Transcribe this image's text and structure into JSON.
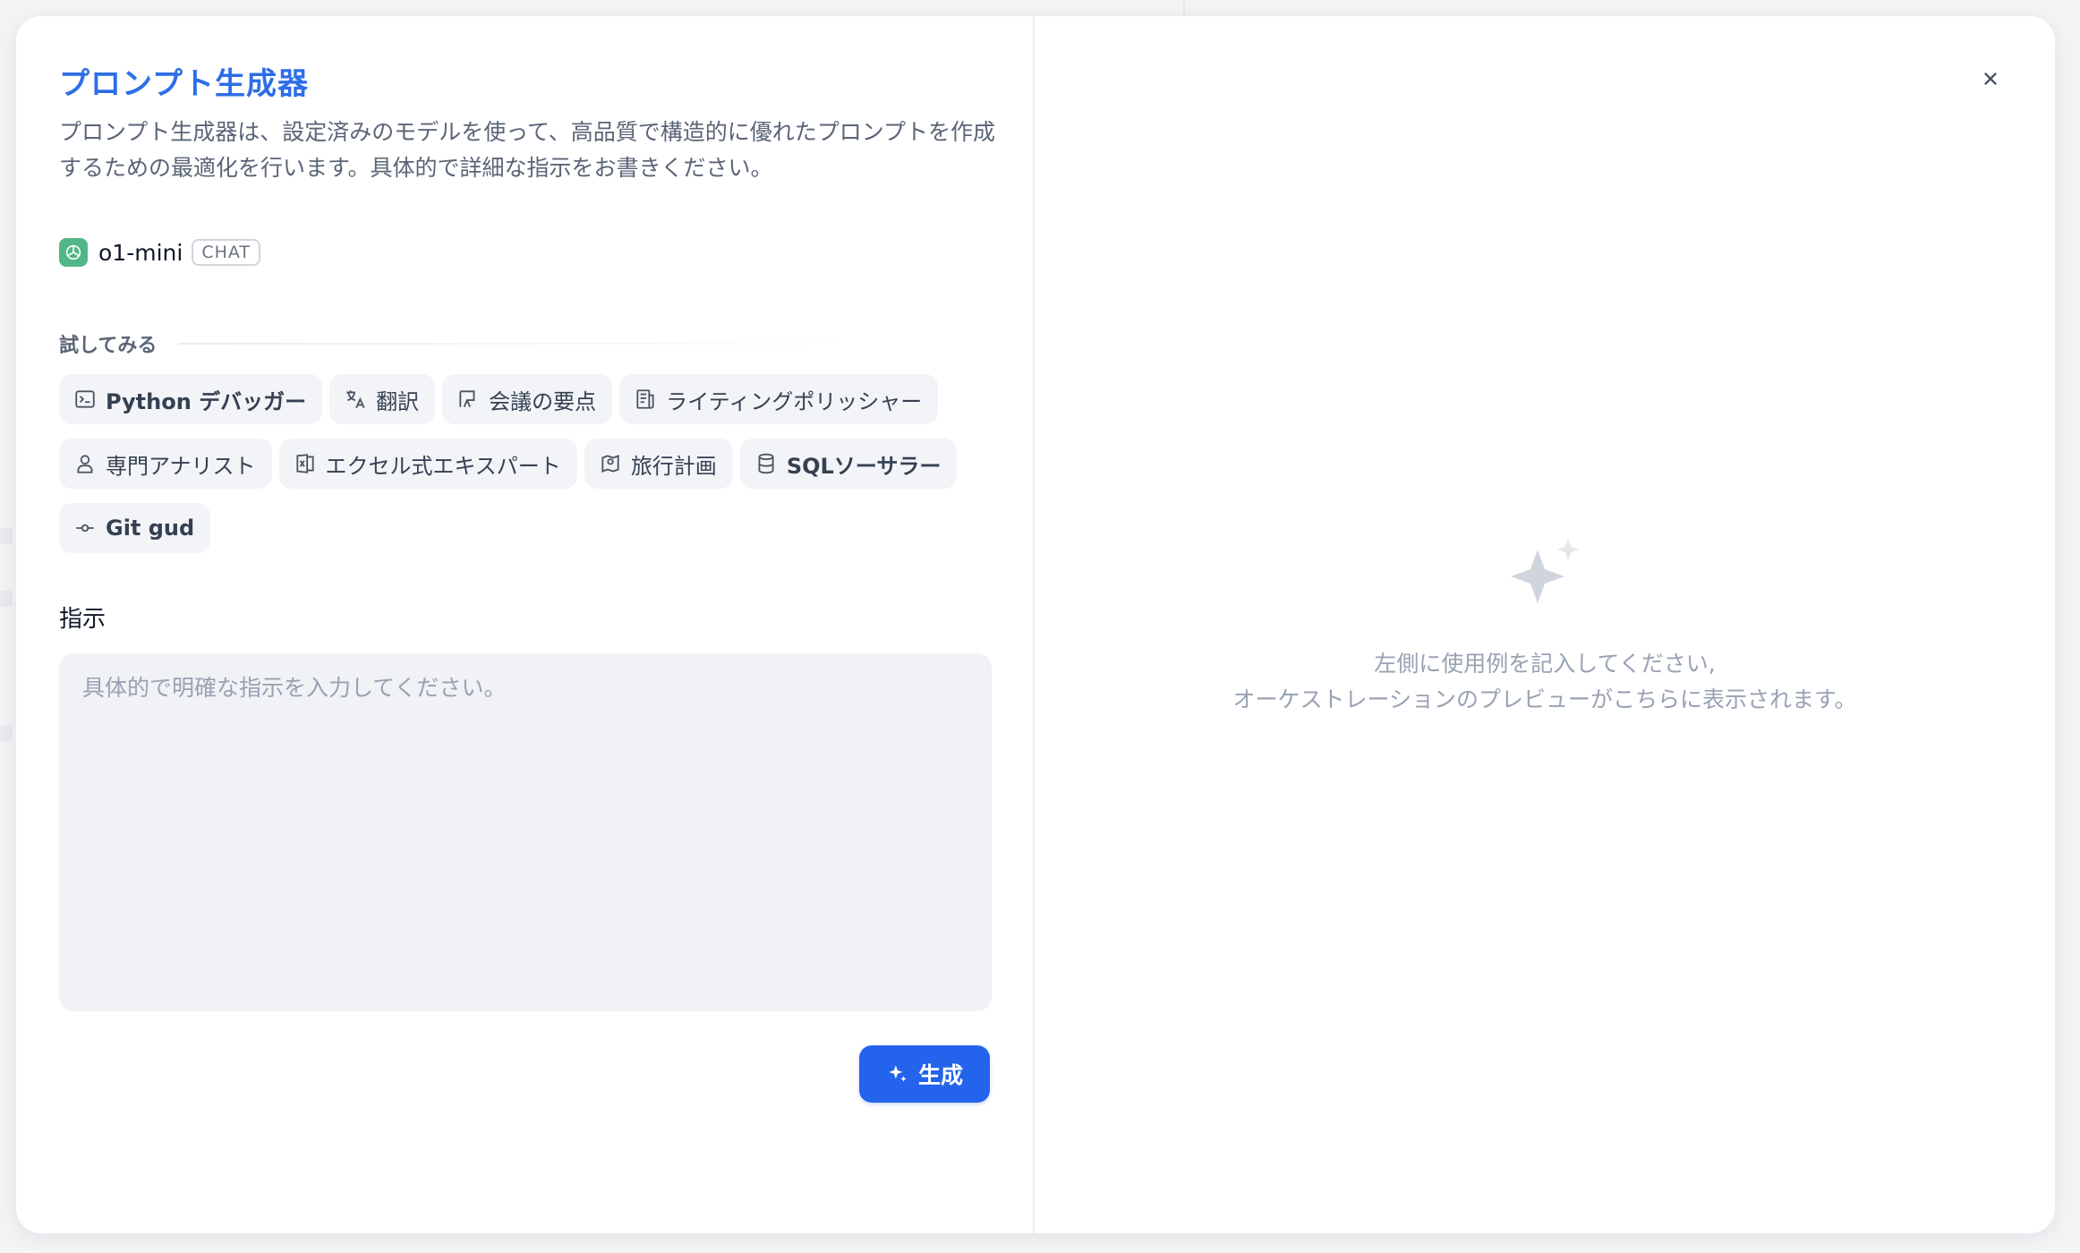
{
  "modal": {
    "title": "プロンプト生成器",
    "description": "プロンプト生成器は、設定済みのモデルを使って、高品質で構造的に優れたプロンプトを作成するための最適化を行います。具体的で詳細な指示をお書きください。"
  },
  "model": {
    "name": "o1-mini",
    "tag": "CHAT"
  },
  "try_section": {
    "label": "試してみる",
    "chips": [
      {
        "icon": "terminal-icon",
        "label": "Python デバッガー"
      },
      {
        "icon": "translate-icon",
        "label": "翻訳"
      },
      {
        "icon": "presentation-icon",
        "label": "会議の要点"
      },
      {
        "icon": "newspaper-icon",
        "label": "ライティングポリッシャー"
      },
      {
        "icon": "user-icon",
        "label": "専門アナリスト"
      },
      {
        "icon": "excel-icon",
        "label": "エクセル式エキスパート"
      },
      {
        "icon": "map-pin-icon",
        "label": "旅行計画"
      },
      {
        "icon": "database-icon",
        "label": "SQLソーサラー"
      },
      {
        "icon": "git-commit-icon",
        "label": "Git gud"
      }
    ]
  },
  "instruction": {
    "label": "指示",
    "value": "",
    "placeholder": "具体的で明確な指示を入力してください。"
  },
  "generate_button": {
    "label": "生成"
  },
  "preview": {
    "empty_line1": "左側に使用例を記入してください,",
    "empty_line2": "オーケストレーションのプレビューがこちらに表示されます。"
  },
  "colors": {
    "accent": "#2463eb",
    "title": "#2d6ee8",
    "model_icon": "#52b788"
  }
}
